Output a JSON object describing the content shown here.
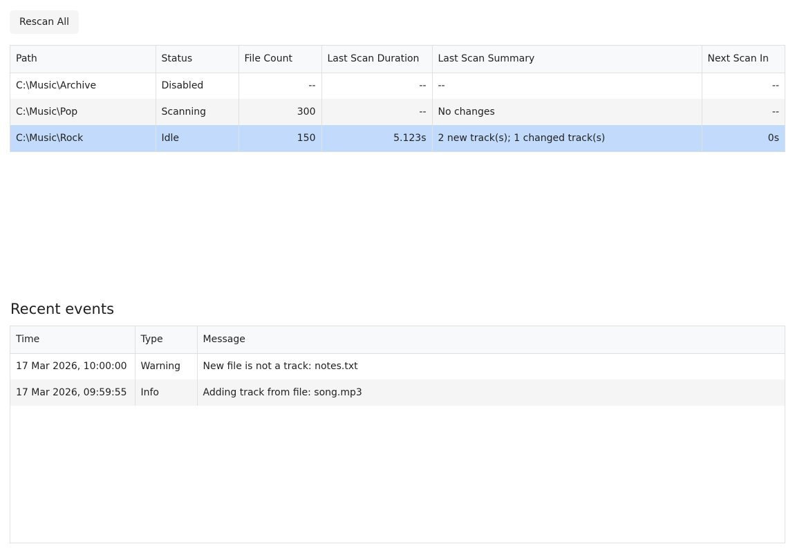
{
  "toolbar": {
    "rescan_label": "Rescan All"
  },
  "folders": {
    "columns": [
      "Path",
      "Status",
      "File Count",
      "Last Scan Duration",
      "Last Scan Summary",
      "Next Scan In"
    ],
    "rows": [
      [
        "C:\\Music\\Archive",
        "Disabled",
        "--",
        "--",
        "--",
        "--"
      ],
      [
        "C:\\Music\\Pop",
        "Scanning",
        "300",
        "--",
        "No changes",
        "--"
      ],
      [
        "C:\\Music\\Rock",
        "Idle",
        "150",
        "5.123s",
        "2 new track(s); 1 changed track(s)",
        "0s"
      ]
    ],
    "selected_row": 2
  },
  "events": {
    "title": "Recent events",
    "columns": [
      "Time",
      "Type",
      "Message"
    ],
    "rows": [
      [
        "17 Mar 2026, 10:00:00",
        "Warning",
        "New file is not a track: notes.txt"
      ],
      [
        "17 Mar 2026, 09:59:55",
        "Info",
        "Adding track from file: song.mp3"
      ]
    ]
  },
  "colors": {
    "header_bg": "#f8f9fa",
    "alt_row_bg": "#f5f5f5",
    "selected_row_bg": "#c2dbfc",
    "border": "#e0e0e0"
  }
}
